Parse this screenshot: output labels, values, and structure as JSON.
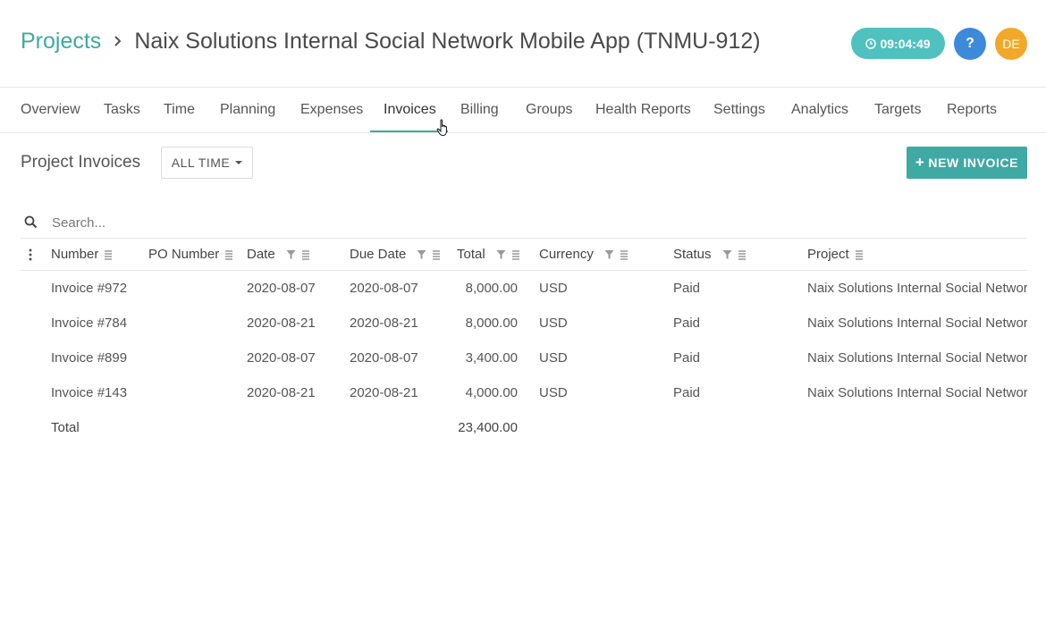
{
  "header": {
    "breadcrumb_root": "Projects",
    "project_title": "Naix Solutions Internal Social Network Mobile App (TNMU-912)",
    "timer": "09:04:49",
    "help_label": "?",
    "avatar_initials": "DE"
  },
  "tabs": [
    {
      "label": "Overview"
    },
    {
      "label": "Tasks"
    },
    {
      "label": "Time"
    },
    {
      "label": "Planning"
    },
    {
      "label": "Expenses"
    },
    {
      "label": "Invoices",
      "active": true
    },
    {
      "label": "Billing"
    },
    {
      "label": "Groups"
    },
    {
      "label": "Health Reports"
    },
    {
      "label": "Settings"
    },
    {
      "label": "Analytics"
    },
    {
      "label": "Targets"
    },
    {
      "label": "Reports"
    }
  ],
  "toolbar": {
    "section_title": "Project Invoices",
    "time_filter": "ALL TIME",
    "new_invoice_label": "NEW INVOICE"
  },
  "search": {
    "placeholder": "Search..."
  },
  "table": {
    "columns": [
      "Number",
      "PO Number",
      "Date",
      "Due Date",
      "Total",
      "Currency",
      "Status",
      "Project"
    ],
    "rows": [
      {
        "number": "Invoice #972",
        "po": "",
        "date": "2020-08-07",
        "due": "2020-08-07",
        "total": "8,000.00",
        "currency": "USD",
        "status": "Paid",
        "project": "Naix Solutions Internal Social Network"
      },
      {
        "number": "Invoice #784",
        "po": "",
        "date": "2020-08-21",
        "due": "2020-08-21",
        "total": "8,000.00",
        "currency": "USD",
        "status": "Paid",
        "project": "Naix Solutions Internal Social Network"
      },
      {
        "number": "Invoice #899",
        "po": "",
        "date": "2020-08-07",
        "due": "2020-08-07",
        "total": "3,400.00",
        "currency": "USD",
        "status": "Paid",
        "project": "Naix Solutions Internal Social Network"
      },
      {
        "number": "Invoice #143",
        "po": "",
        "date": "2020-08-21",
        "due": "2020-08-21",
        "total": "4,000.00",
        "currency": "USD",
        "status": "Paid",
        "project": "Naix Solutions Internal Social Network"
      }
    ],
    "total_label": "Total",
    "total_value": "23,400.00"
  },
  "colors": {
    "accent": "#3fa9a3",
    "timer": "#4fc2bf",
    "help": "#3c8ad9",
    "avatar": "#f2a82a"
  }
}
